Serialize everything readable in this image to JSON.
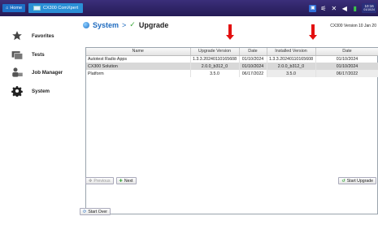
{
  "topbar": {
    "home_label": "Home",
    "app_tab_label": "CX300 ComXpert",
    "clock_time": "10:16",
    "clock_sub": "01/10/24"
  },
  "sidebar": {
    "items": [
      {
        "label": "Favorites",
        "icon": "star-icon"
      },
      {
        "label": "Tests",
        "icon": "tests-icon"
      },
      {
        "label": "Job Manager",
        "icon": "job-manager-icon"
      },
      {
        "label": "System",
        "icon": "gear-icon"
      }
    ]
  },
  "header": {
    "crumb_system": "System",
    "crumb_sep": ">",
    "crumb_page": "Upgrade",
    "version_info": "CX300 Version 10 Jan 20"
  },
  "table": {
    "columns": [
      "Name",
      "Upgrade Version",
      "Date",
      "Installed Version",
      "Date"
    ],
    "rows": [
      [
        "Autotest Radio Apps",
        "1.3.3.20240110165608",
        "01/10/2024",
        "1.3.3.20240110165608",
        "01/10/2024"
      ],
      [
        "CX300 Solution",
        "2.0.0_b312_0",
        "01/10/2024",
        "2.0.0_b312_0",
        "01/10/2024"
      ],
      [
        "Platform",
        "3.5.0",
        "06/17/2022",
        "3.5.0",
        "06/17/2022"
      ]
    ]
  },
  "buttons": {
    "previous": "Previous",
    "next": "Next",
    "start_upgrade": "Start Upgrade",
    "start_over": "Start Over"
  },
  "colors": {
    "accent": "#1e6bbf",
    "topbar": "#2b2165",
    "arrow": "#e31010",
    "selected_row": "#d8d8d8"
  }
}
